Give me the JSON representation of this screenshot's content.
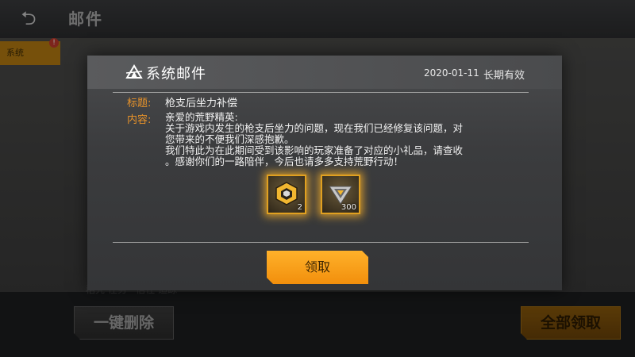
{
  "background": {
    "back_icon": "back-arrow-icon",
    "title": "邮件",
    "tab_label": "系统",
    "tab_badge": "!",
    "row_text": "稻壳 任务 · 信任 追踪",
    "delete_all_label": "一键删除",
    "claim_all_label": "全部领取"
  },
  "mail": {
    "logo_icon": "game-logo-icon",
    "title": "系统邮件",
    "date": "2020-01-11",
    "expiry": "长期有效",
    "subject_label": "标题:",
    "subject": "枪支后坐力补偿",
    "content_label": "内容:",
    "body": [
      "亲爱的荒野精英:",
      "关于游戏内发生的枪支后坐力的问题，现在我们已经修复该问题，对",
      "您带来的不便我们深感抱歉。",
      "我们特此为在此期间受到该影响的玩家准备了对应的小礼品，请查收",
      "。感谢你们的一路陪伴，今后也请多多支持荒野行动！"
    ],
    "rewards": [
      {
        "icon": "supply-crate-icon",
        "quantity": "2"
      },
      {
        "icon": "rank-badge-icon",
        "quantity": "300"
      }
    ],
    "claim_label": "领取"
  },
  "colors": {
    "accent_orange": "#f5a01e",
    "label_orange": "#e8932a",
    "reward_glow": "#ffb428"
  }
}
